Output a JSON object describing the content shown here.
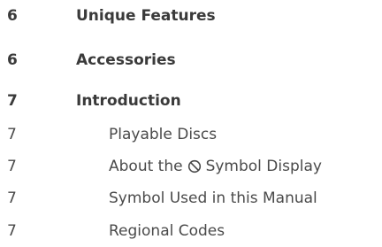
{
  "toc": {
    "entries": [
      {
        "page": "6",
        "title": "Unique Features"
      },
      {
        "page": "6",
        "title": "Accessories"
      },
      {
        "page": "7",
        "title": "Introduction"
      },
      {
        "page": "7",
        "title": "Playable Discs"
      },
      {
        "page": "7",
        "title_before": "About the",
        "title_after": "Symbol Display",
        "icon": "prohibition-symbol-icon"
      },
      {
        "page": "7",
        "title": "Symbol Used in this Manual"
      },
      {
        "page": "7",
        "title": "Regional Codes"
      }
    ]
  }
}
